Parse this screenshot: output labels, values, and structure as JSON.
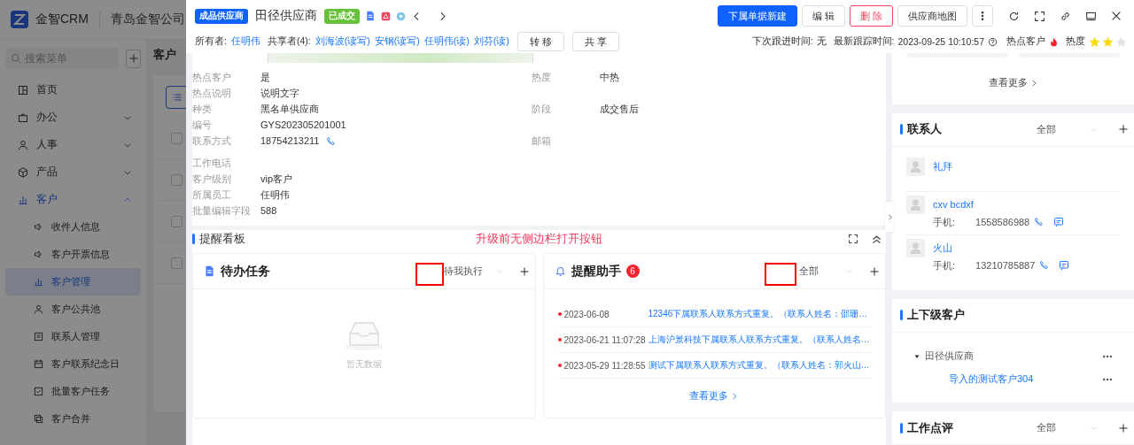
{
  "app": {
    "brand": "金智CRM",
    "company": "青岛金智公司",
    "search": {
      "placeholder": "搜索菜单"
    },
    "menu": [
      {
        "label": "首页",
        "kind": "page",
        "selected": false
      },
      {
        "label": "办公",
        "kind": "group",
        "selected": false,
        "expanded": false
      },
      {
        "label": "人事",
        "kind": "group",
        "selected": false,
        "expanded": false
      },
      {
        "label": "产品",
        "kind": "group",
        "selected": false,
        "expanded": false
      },
      {
        "label": "客户",
        "kind": "group",
        "selected": true,
        "expanded": true,
        "children": [
          {
            "label": "收件人信息",
            "selected": false
          },
          {
            "label": "客户开票信息",
            "selected": false
          },
          {
            "label": "客户管理",
            "selected": true
          },
          {
            "label": "客户公共池",
            "selected": false
          },
          {
            "label": "联系人管理",
            "selected": false
          },
          {
            "label": "客户联系纪念日",
            "selected": false
          },
          {
            "label": "批量客户任务",
            "selected": false
          },
          {
            "label": "客户合并",
            "selected": false
          }
        ]
      }
    ],
    "page_title": "客户",
    "rows": [
      {
        "checked": false
      },
      {
        "checked": false
      },
      {
        "checked": false
      },
      {
        "checked": false
      }
    ]
  },
  "header": {
    "type_tag": "成品供应商",
    "title": "田径供应商",
    "status_tag": "已成交",
    "buttons": [
      {
        "label": "下属单据新建",
        "kind": "primary"
      },
      {
        "label": "编 辑",
        "kind": "default"
      },
      {
        "label": "删 除",
        "kind": "danger"
      },
      {
        "label": "供应商地图",
        "kind": "default"
      }
    ],
    "owner_label": "所有者:",
    "owner": "任明伟",
    "sharers_label": "共享者(4):",
    "sharers": [
      "刘海波(读写)",
      "安钢(读写)",
      "任明伟(读)",
      "刘芬(读)"
    ],
    "actions": [
      "转 移",
      "共 享"
    ],
    "next_follow_label": "下次跟进时间:",
    "next_follow": "无",
    "last_track_label": "最新跟踪时间:",
    "last_track": "2023-09-25 10:10:57",
    "hot_label": "热点客户",
    "heat_label": "热度",
    "stars": 2
  },
  "info": {
    "rows": [
      [
        {
          "label": "热点客户",
          "value": "是"
        },
        {
          "label": "热度",
          "value": "中热"
        }
      ],
      [
        {
          "label": "热点说明",
          "value": "说明文字"
        }
      ],
      [
        {
          "label": "种类",
          "value": "黑名单供应商"
        },
        {
          "label": "阶段",
          "value": "成交售后"
        }
      ],
      [
        {
          "label": "编号",
          "value": "GYS202305201001"
        }
      ],
      [
        {
          "label": "联系方式",
          "value": "18754213211",
          "kind": "phone"
        },
        {
          "label": "邮箱"
        }
      ],
      [
        {
          "label": "工作电话"
        }
      ],
      [
        {
          "label": "客户级别",
          "value": "vip客户"
        }
      ],
      [
        {
          "label": "所属员工",
          "value": "任明伟"
        }
      ],
      [
        {
          "label": "批量编辑字段",
          "value": "588"
        }
      ]
    ]
  },
  "reminder": {
    "title": "提醒看板",
    "note": "升级前无侧边栏打开按钮",
    "todo": {
      "title": "待办任务",
      "filter": "待我执行",
      "empty": "暂无数据"
    },
    "assistant": {
      "title": "提醒助手",
      "badge": "6",
      "filter": "全部",
      "more": "查看更多",
      "items": [
        {
          "time": "2023-06-08",
          "text": "12346下属联系人联系方式重复。（联系人姓名：邵珊…"
        },
        {
          "time": "2023-06-21 11:07:28",
          "text": "上海沪景科技下属联系人联系方式重复。（联系人姓名…"
        },
        {
          "time": "2023-05-29 11:28:55",
          "text": "测试下属联系人联系方式重复。（联系人姓名：郭火山…"
        }
      ]
    }
  },
  "side_panel": {
    "top": {
      "more": "查看更多"
    },
    "contacts": {
      "title": "联系人",
      "filter": "全部",
      "items": [
        {
          "name": "礼拜"
        },
        {
          "name": "cxv bcdxf",
          "phone_label": "手机:",
          "phone": "1558586988"
        },
        {
          "name": "火山",
          "phone_label": "手机:",
          "phone": "13210785887"
        }
      ]
    },
    "related": {
      "title": "上下级客户",
      "tree": [
        {
          "label": "田径供应商",
          "expanded": true,
          "children": [
            {
              "label": "导入的测试客户304"
            }
          ]
        }
      ]
    },
    "review": {
      "title": "工作点评",
      "filter": "全部"
    }
  }
}
